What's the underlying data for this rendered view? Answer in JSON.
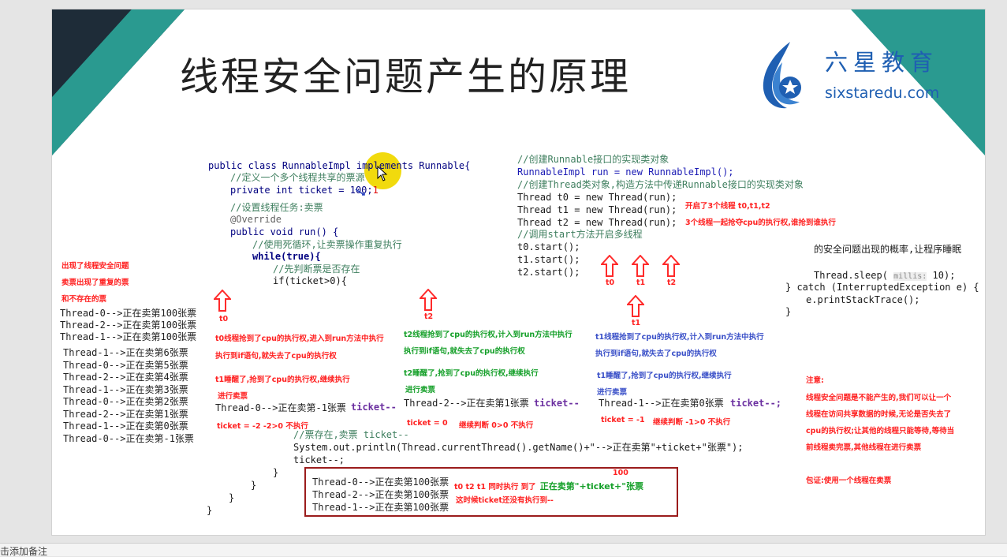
{
  "slide": {
    "title": "线程安全问题产生的原理",
    "logo_cn": "六星教育",
    "logo_en": "sixstaredu.com"
  },
  "code_left": {
    "l1": "public class RunnableImpl implements Runnable{",
    "l2": "//定义一个多个线程共享的票源",
    "l3": "private  int ticket = 100;",
    "l3_mark": "1",
    "l4": "//设置线程任务:卖票",
    "l5": "@Override",
    "l6": "public void run() {",
    "l7": "//使用死循环,让卖票操作重复执行",
    "l8": "while(true){",
    "l9": "//先判断票是否存在",
    "l10": "if(ticket>0){",
    "l11": "//票存在,卖票 ticket--",
    "l12": "System.out.println(Thread.currentThread().getName()+\"-->正在卖第\"+ticket+\"张票\");",
    "l13": "ticket--;",
    "l14": "}",
    "l15": "}",
    "l16": "}",
    "l17": "}"
  },
  "code_right": {
    "r1": "//创建Runnable接口的实现类对象",
    "r2": "RunnableImpl run = new RunnableImpl();",
    "r3": "//创建Thread类对象,构造方法中传递Runnable接口的实现类对象",
    "r4": "Thread t0 = new Thread(run);",
    "r5": "Thread t1 = new Thread(run);",
    "r6": "Thread t2 = new Thread(run);",
    "r7": "//调用start方法开启多线程",
    "r8": "t0.start();",
    "r9": "t1.start();",
    "r10": "t2.start();"
  },
  "code_far_right": {
    "f1": "的安全问题出现的概率,让程序睡眠",
    "f2": "Thread.sleep(",
    "f2_hint": "millis:",
    "f2_end": "10);",
    "f3": "} catch (InterruptedException e) {",
    "f4": "e.printStackTrace();",
    "f5": "}"
  },
  "notes_left": {
    "n1": "出现了线程安全问题",
    "n2": "卖票出现了重复的票",
    "n3": "和不存在的票"
  },
  "output_left": [
    "Thread-0-->正在卖第100张票",
    "Thread-2-->正在卖第100张票",
    "Thread-1-->正在卖第100张票",
    "Thread-1-->正在卖第6张票",
    "Thread-0-->正在卖第5张票",
    "Thread-2-->正在卖第4张票",
    "Thread-1-->正在卖第3张票",
    "Thread-0-->正在卖第2张票",
    "Thread-2-->正在卖第1张票",
    "Thread-1-->正在卖第0张票",
    "Thread-0-->正在卖第-1张票"
  ],
  "threads": {
    "t0_label": "t0",
    "t0_a": "t0线程抢到了cpu的执行权,进入到run方法中执行",
    "t0_b": "执行到if语句,就失去了cpu的执行权",
    "t0_c": "t1睡醒了,抢到了cpu的执行权,继续执行",
    "t0_d": "进行卖票",
    "t0_out": "Thread-0-->正在卖第-1张票",
    "t0_dec": "ticket--",
    "t0_e": "ticket = -2  -2>0 不执行",
    "t2_label": "t2",
    "t2_a": "t2线程抢到了cpu的执行权,计入到run方法中执行",
    "t2_b": "执行到if语句,就失去了cpu的执行权",
    "t2_c": "t2睡醒了,抢到了cpu的执行权,继续执行",
    "t2_d": "进行卖票",
    "t2_out": "Thread-2-->正在卖第1张票",
    "t2_dec": "ticket--",
    "t2_e": "ticket = 0",
    "t2_f": "继续判断 0>0 不执行",
    "t1_label": "t1",
    "t1_a": "t1线程抢到了cpu的执行权,计入到run方法中执行",
    "t1_b": "执行到if语句,就失去了cpu的执行权",
    "t1_c": "t1睡醒了,抢到了cpu的执行权,继续执行",
    "t1_d": "进行卖票",
    "t1_out": "Thread-1-->正在卖第0张票",
    "t1_dec": "ticket--;",
    "t1_e": "ticket = -1",
    "t1_f": "继续判断 -1>0 不执行",
    "start_a": "开启了3个线程 t0,t1,t2",
    "start_b": "3个线程一起抢夺cpu的执行权,谁抢到谁执行",
    "up_t0": "t0",
    "up_t1": "t1",
    "up_t2": "t2"
  },
  "box": {
    "o1": "Thread-0-->正在卖第100张票",
    "o2": "Thread-2-->正在卖第100张票",
    "o3": "Thread-1-->正在卖第100张票",
    "note1": "t0 t2 t1 同时执行 到了",
    "note_code": "正在卖第\"+ticket+\"张票",
    "note2": "这时候ticket还没有执行到--",
    "num": "100"
  },
  "notice": {
    "title": "注意:",
    "p1": "线程安全问题是不能产生的,我们可以让一个",
    "p2": "线程在访问共享数据的时候,无论是否失去了",
    "p3": "cpu的执行权;让其他的线程只能等待,等待当",
    "p4": "前线程卖完票,其他线程在进行卖票",
    "guarantee": "包证:使用一个线程在卖票"
  },
  "bottom_bar": {
    "text": "击添加备注"
  }
}
